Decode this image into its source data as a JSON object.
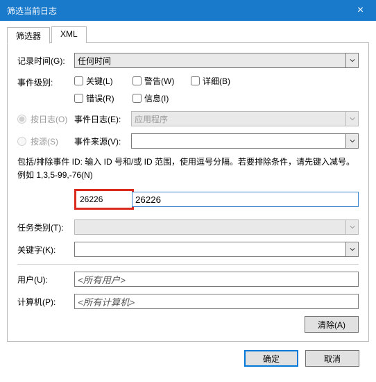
{
  "window": {
    "title": "筛选当前日志",
    "close": "×"
  },
  "tabs": {
    "filter": "筛选器",
    "xml": "XML"
  },
  "labels": {
    "logged": "记录时间(G):",
    "level": "事件级别:",
    "byLog": "按日志(O)",
    "bySource": "按源(S)",
    "eventLogs": "事件日志(E):",
    "eventSources": "事件来源(V):",
    "help": "包括/排除事件 ID: 输入 ID 号和/或 ID 范围，使用逗号分隔。若要排除条件，请先键入减号。例如 1,3,5-99,-76(N)",
    "taskCategory": "任务类别(T):",
    "keywords": "关键字(K):",
    "user": "用户(U):",
    "computer": "计算机(P):"
  },
  "level": {
    "critical": "关键(L)",
    "warning": "警告(W)",
    "verbose": "详细(B)",
    "error": "错误(R)",
    "info": "信息(I)"
  },
  "values": {
    "logged": "任何时间",
    "eventLogs": "应用程序",
    "eventSources": "",
    "eventId": "26226",
    "taskCategory": "",
    "keywords": "",
    "user": "<所有用户>",
    "computer": "<所有计算机>"
  },
  "buttons": {
    "clear": "清除(A)",
    "ok": "确定",
    "cancel": "取消"
  }
}
